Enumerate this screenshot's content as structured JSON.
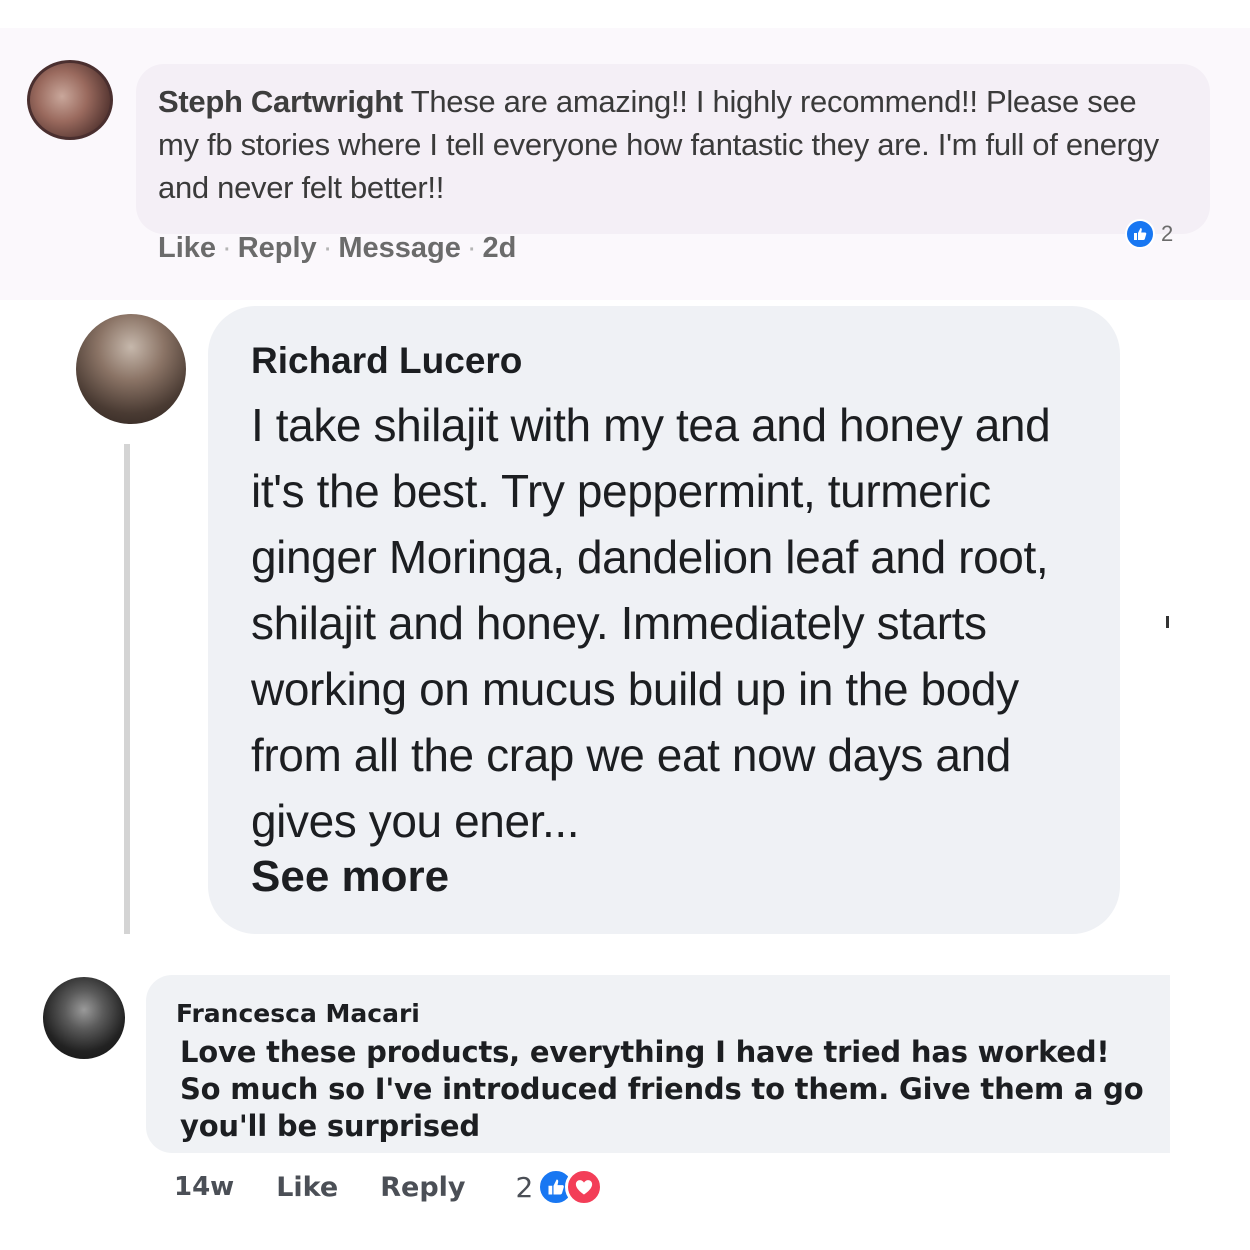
{
  "comments": [
    {
      "author": "Steph Cartwright",
      "text": "These are amazing!! I highly recommend!! Please see my fb stories where I tell everyone how fantastic they are. I'm full of energy and never felt better!!",
      "actions": {
        "like": "Like",
        "reply": "Reply",
        "message": "Message",
        "time": "2d",
        "separator": "·"
      },
      "reactions": {
        "icons": [
          "like-icon"
        ],
        "count": "2"
      }
    },
    {
      "author": "Richard Lucero",
      "text": "I take shilajit with my tea and honey and it's the best. Try peppermint, turmeric ginger Moringa, dandelion leaf and root, shilajit and honey. Immediately starts working on mucus build up in the body from all the crap we eat now days and gives you ener...",
      "see_more": "See more"
    },
    {
      "author": "Francesca Macari",
      "text": "Love these products, everything I have tried has worked! So much so I've introduced friends to them. Give them a go you'll be surprised",
      "actions": {
        "time": "14w",
        "like": "Like",
        "reply": "Reply"
      },
      "reactions": {
        "count": "2",
        "icons": [
          "like-icon",
          "love-icon"
        ]
      }
    }
  ],
  "colors": {
    "facebook_blue": "#1877f2",
    "love_red": "#f33e58",
    "bubble_gray": "#f0f2f5",
    "text_dark": "#1c1e21",
    "action_gray": "#6b6b6b"
  }
}
